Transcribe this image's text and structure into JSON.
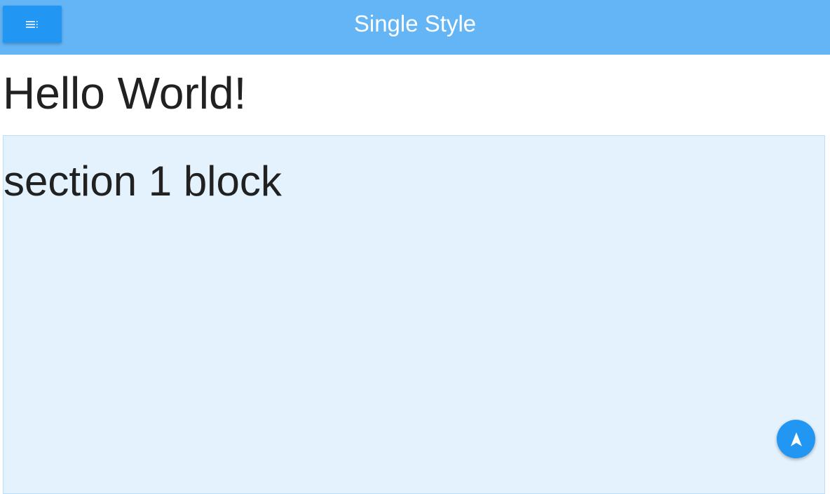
{
  "header": {
    "title": "Single Style",
    "menu_icon": "menu-icon",
    "background": "#64b5f6",
    "button_color": "#2196f3"
  },
  "main": {
    "heading": "Hello World!",
    "section": {
      "text": "section 1 block",
      "background": "#e3f2fd"
    }
  },
  "fab": {
    "icon": "navigation-arrow-icon",
    "color": "#2196f3"
  }
}
